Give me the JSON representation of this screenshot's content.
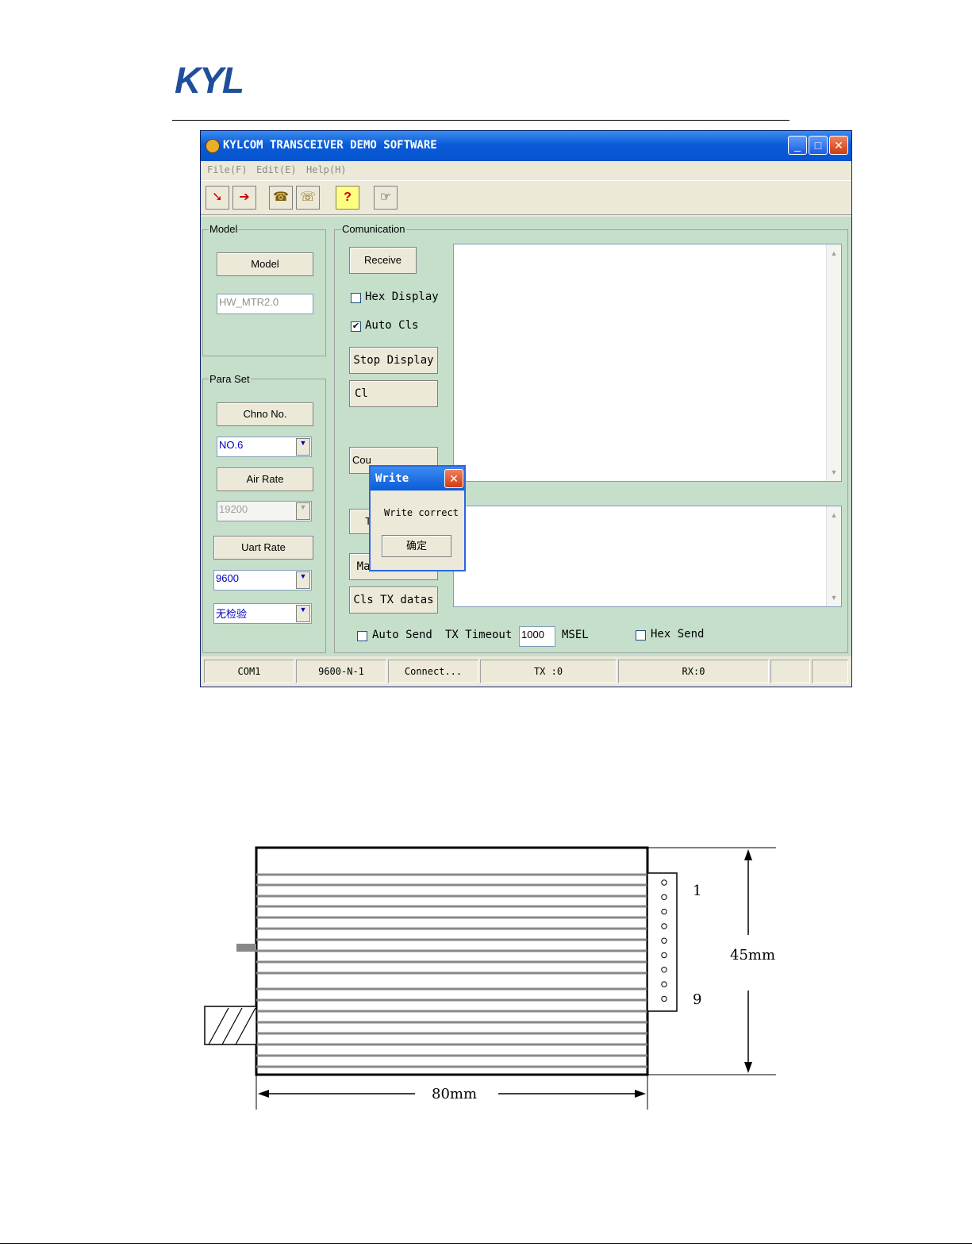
{
  "logo": {
    "text": "KYL"
  },
  "window": {
    "title": "KYLCOM TRANSCEIVER DEMO SOFTWARE",
    "controls": {
      "minimize": "_",
      "maximize": "□",
      "close": "✕"
    },
    "menu": [
      "File(F)",
      "Edit(E)",
      "Help(H)"
    ],
    "toolbar_icons": [
      "open-file-icon",
      "save-file-icon",
      "phone-connect-icon",
      "phone-disconnect-icon",
      "help-icon",
      "pointer-icon"
    ]
  },
  "model_group": {
    "label": "Model",
    "button": "Model",
    "value": "HW_MTR2.0"
  },
  "para_group": {
    "label": "Para Set",
    "chno_button": "Chno No.",
    "chno_value": "NO.6",
    "air_rate_button": "Air Rate",
    "air_rate_value": "19200",
    "uart_rate_button": "Uart Rate",
    "uart_rate_value": "9600",
    "parity_value": "无检验"
  },
  "comm_group": {
    "label": "Comunication",
    "receive_button": "Receive",
    "hex_display": "Hex Display",
    "auto_cls": "Auto Cls",
    "auto_cls_checked": "✔",
    "stop_display": "Stop Display",
    "cls_button_partial": "Cl",
    "count_button_partial": "Cou",
    "transmit_button": "Transmitt",
    "manual_send": "Manual Send",
    "cls_tx": "Cls TX datas",
    "auto_send": "Auto Send",
    "tx_timeout_label": "TX Timeout",
    "tx_timeout_value": "1000",
    "msel": "MSEL",
    "hex_send": "Hex Send"
  },
  "status": [
    "COM1",
    "9600-N-1",
    "Connect...",
    "TX :0",
    "RX:0",
    "",
    ""
  ],
  "dialog": {
    "title": "Write",
    "message": "Write correct",
    "ok": "确定",
    "close": "✕"
  },
  "diagram": {
    "pin_top": "1",
    "pin_bottom": "9",
    "height": "45mm",
    "width": "80mm"
  }
}
